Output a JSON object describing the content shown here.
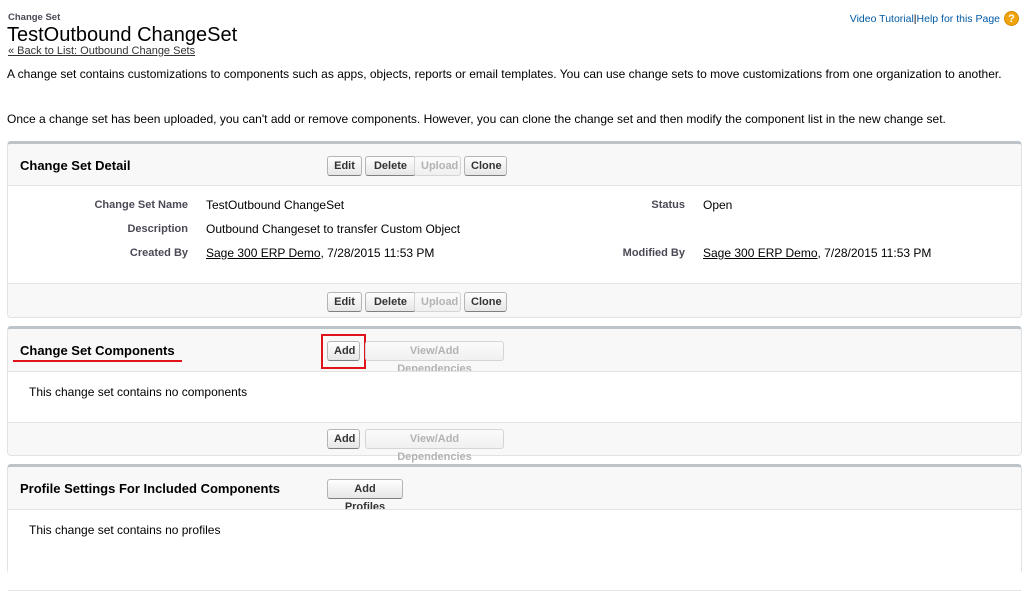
{
  "header": {
    "section_label": "Change Set",
    "title": "TestOutbound ChangeSet",
    "back_link": "« Back to List: Outbound Change Sets",
    "video_tutorial": "Video Tutorial",
    "separator": "|",
    "help_link": "Help for this Page",
    "help_icon_glyph": "?"
  },
  "intro": {
    "paragraph1": "A change set contains customizations to components such as apps, objects, reports or email templates. You can use change sets to move customizations from one organization to another.",
    "paragraph2": "Once a change set has been uploaded, you can't add or remove components. However, you can clone the change set and then modify the component list in the new change set."
  },
  "detail": {
    "title": "Change Set Detail",
    "buttons": {
      "edit": "Edit",
      "delete": "Delete",
      "upload": "Upload",
      "clone": "Clone"
    },
    "fields": {
      "name_label": "Change Set Name",
      "name_value": "TestOutbound ChangeSet",
      "status_label": "Status",
      "status_value": "Open",
      "description_label": "Description",
      "description_value": "Outbound Changeset to transfer Custom Object",
      "created_label": "Created By",
      "created_user": "Sage 300 ERP Demo",
      "created_date": ", 7/28/2015 11:53 PM",
      "modified_label": "Modified By",
      "modified_user": "Sage 300 ERP Demo",
      "modified_date": ", 7/28/2015 11:53 PM"
    }
  },
  "components": {
    "title": "Change Set Components",
    "add_button": "Add",
    "dependencies_button": "View/Add Dependencies",
    "empty_message": "This change set contains no components"
  },
  "profiles": {
    "title": "Profile Settings For Included Components",
    "add_profiles_button": "Add Profiles",
    "empty_message": "This change set contains no profiles"
  },
  "colors": {
    "link": "#015ba7",
    "highlight": "#e0131b",
    "help_icon": "#f0a30a"
  }
}
